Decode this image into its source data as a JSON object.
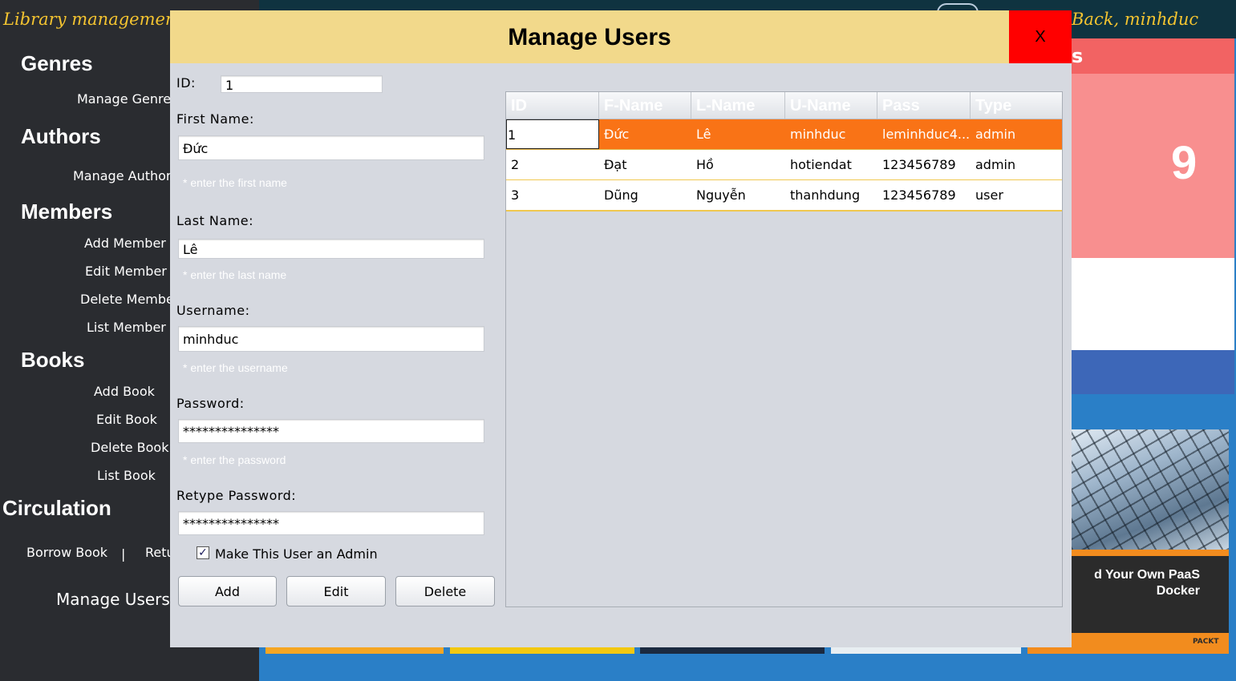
{
  "app": {
    "title": "Library managemer",
    "welcome": "Back, minhduc"
  },
  "sidebar": {
    "genres_head": "Genres",
    "manage_genres": "Manage Genre",
    "authors_head": "Authors",
    "manage_authors": "Manage Author",
    "members_head": "Members",
    "add_member": "Add Member",
    "edit_member": "Edit Member",
    "delete_member": "Delete Membe",
    "list_member": "List Member",
    "books_head": "Books",
    "add_book": "Add Book",
    "edit_book": "Edit Book",
    "delete_book": "Delete Book",
    "list_book": "List Book",
    "circulation_head": "Circulation",
    "borrow_book": "Borrow Book",
    "separator": "|",
    "return_book": "Retu",
    "manage_users": "Manage Users"
  },
  "dashboard": {
    "card_head": "s",
    "card_count": "9",
    "book_title": "d Your Own PaaS\nDocker",
    "book_publisher": "PACKT"
  },
  "dialog": {
    "title": "Manage Users",
    "close": "X",
    "form": {
      "id_label": "ID:",
      "id_value": "1",
      "first_name_label": "First Name:",
      "first_name_value": "Đức",
      "first_name_hint": "* enter the first name",
      "last_name_label": "Last Name:",
      "last_name_value": "Lê",
      "last_name_hint": "* enter the last name",
      "username_label": "Username:",
      "username_value": "minhduc",
      "username_hint": "* enter the username",
      "password_label": "Password:",
      "password_value": "***************",
      "password_hint": "* enter the password",
      "retype_label": "Retype Password:",
      "retype_value": "***************",
      "admin_checked": true,
      "admin_check_mark": "✓",
      "admin_label": "Make This User an Admin",
      "add_button": "Add",
      "edit_button": "Edit",
      "delete_button": "Delete"
    },
    "table": {
      "columns": [
        "ID",
        "F-Name",
        "L-Name",
        "U-Name",
        "Pass",
        "Type"
      ],
      "rows": [
        [
          "1",
          "Đức",
          "Lê",
          "minhduc",
          "leminhduc4...",
          "admin"
        ],
        [
          "2",
          "Đạt",
          "Hồ",
          "hotiendat",
          "123456789",
          "admin"
        ],
        [
          "3",
          "Dũng",
          "Nguyễn",
          "thanhdung",
          "123456789",
          "user"
        ]
      ],
      "selected_row": 0,
      "selected_color": "#f97316"
    }
  },
  "colors": {
    "sidebar_bg": "#2a2c30",
    "accent_yellow": "#f4c430",
    "dialog_header": "#f2d98b",
    "close_red": "#ff0000"
  }
}
